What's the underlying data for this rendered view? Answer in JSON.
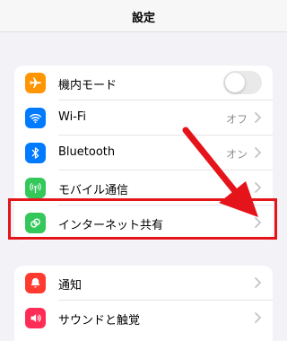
{
  "nav": {
    "title": "設定"
  },
  "group1": [
    {
      "key": "airplane",
      "label": "機内モード",
      "icon": "airplane-icon",
      "color": "#ff9500",
      "toggle": "off"
    },
    {
      "key": "wifi",
      "label": "Wi-Fi",
      "value": "オフ",
      "icon": "wifi-icon",
      "color": "#007aff"
    },
    {
      "key": "bluetooth",
      "label": "Bluetooth",
      "value": "オン",
      "icon": "bluetooth-icon",
      "color": "#007aff"
    },
    {
      "key": "cellular",
      "label": "モバイル通信",
      "icon": "antenna-icon",
      "color": "#34c759"
    },
    {
      "key": "hotspot",
      "label": "インターネット共有",
      "icon": "personal-hotspot-icon",
      "color": "#34c759"
    }
  ],
  "group2": [
    {
      "key": "notifications",
      "label": "通知",
      "icon": "bell-icon",
      "color": "#ff3b30"
    },
    {
      "key": "sounds",
      "label": "サウンドと触覚",
      "icon": "speaker-icon",
      "color": "#ff2d55"
    }
  ],
  "annotation": {
    "highlight_color": "#e5141b",
    "arrow_color": "#e5141b"
  }
}
